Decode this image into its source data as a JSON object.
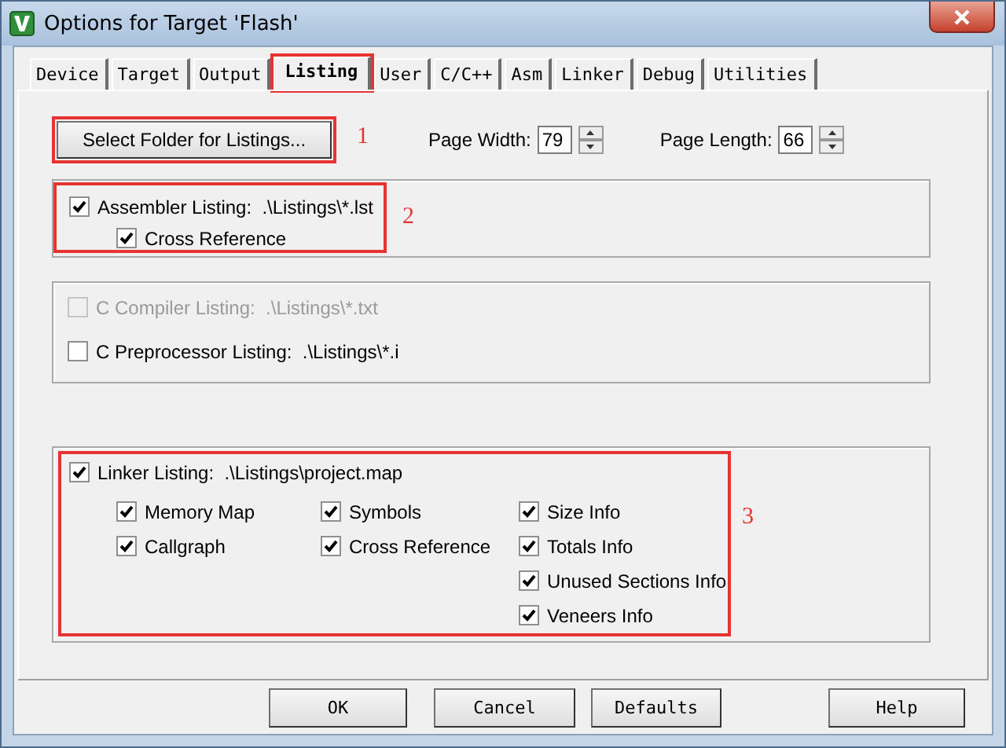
{
  "window": {
    "title": "Options for Target 'Flash'"
  },
  "tabs": [
    {
      "label": "Device",
      "selected": false,
      "highlighted": false
    },
    {
      "label": "Target",
      "selected": false,
      "highlighted": false
    },
    {
      "label": "Output",
      "selected": false,
      "highlighted": false
    },
    {
      "label": "Listing",
      "selected": true,
      "highlighted": true
    },
    {
      "label": "User",
      "selected": false,
      "highlighted": false
    },
    {
      "label": "C/C++",
      "selected": false,
      "highlighted": false
    },
    {
      "label": "Asm",
      "selected": false,
      "highlighted": false
    },
    {
      "label": "Linker",
      "selected": false,
      "highlighted": false
    },
    {
      "label": "Debug",
      "selected": false,
      "highlighted": false
    },
    {
      "label": "Utilities",
      "selected": false,
      "highlighted": false
    }
  ],
  "folder_button": {
    "label": "Select Folder for Listings...",
    "annotation": "1"
  },
  "page_width": {
    "label": "Page Width:",
    "value": "79"
  },
  "page_length": {
    "label": "Page Length:",
    "value": "66"
  },
  "assembler": {
    "annotation": "2",
    "listing": {
      "label": "Assembler Listing:  .\\Listings\\*.lst",
      "checked": true,
      "disabled": false
    },
    "cross_reference": {
      "label": "Cross Reference",
      "checked": true,
      "disabled": false
    }
  },
  "compiler": [
    {
      "label": "C Compiler Listing:  .\\Listings\\*.txt",
      "checked": false,
      "disabled": true
    },
    {
      "label": "C Preprocessor Listing:  .\\Listings\\*.i",
      "checked": false,
      "disabled": false
    }
  ],
  "linker": {
    "annotation": "3",
    "listing": {
      "label": "Linker Listing:  .\\Listings\\project.map",
      "checked": true,
      "disabled": false
    },
    "columns": [
      [
        {
          "label": "Memory Map",
          "checked": true,
          "disabled": false
        },
        {
          "label": "Callgraph",
          "checked": true,
          "disabled": false
        }
      ],
      [
        {
          "label": "Symbols",
          "checked": true,
          "disabled": false
        },
        {
          "label": "Cross Reference",
          "checked": true,
          "disabled": false
        }
      ],
      [
        {
          "label": "Size Info",
          "checked": true,
          "disabled": false
        },
        {
          "label": "Totals Info",
          "checked": true,
          "disabled": false
        },
        {
          "label": "Unused Sections Info",
          "checked": true,
          "disabled": false
        },
        {
          "label": "Veneers Info",
          "checked": true,
          "disabled": false
        }
      ]
    ]
  },
  "buttons": [
    {
      "label": "OK"
    },
    {
      "label": "Cancel"
    },
    {
      "label": "Defaults"
    },
    {
      "label": "Help"
    }
  ]
}
